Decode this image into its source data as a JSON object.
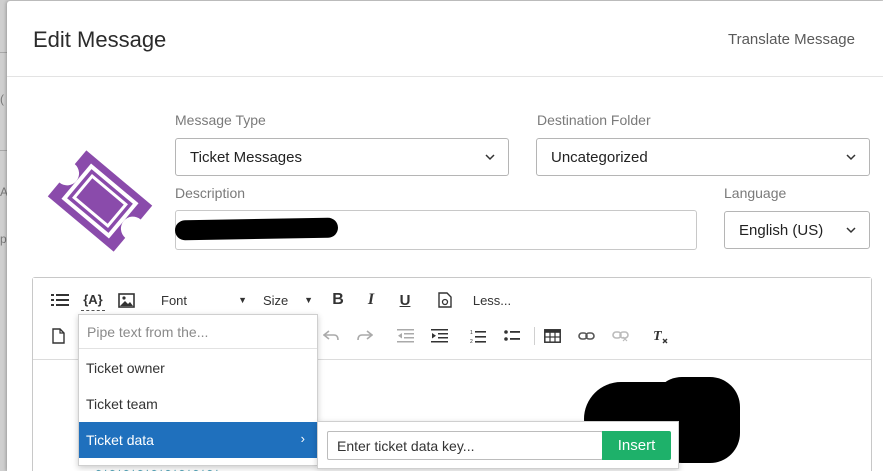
{
  "header": {
    "title": "Edit Message",
    "translate_label": "Translate Message"
  },
  "form": {
    "message_type": {
      "label": "Message Type",
      "value": "Ticket Messages"
    },
    "destination_folder": {
      "label": "Destination Folder",
      "value": "Uncategorized"
    },
    "description": {
      "label": "Description",
      "value": ""
    },
    "language": {
      "label": "Language",
      "value": "English (US)"
    }
  },
  "toolbar": {
    "font_label": "Font",
    "size_label": "Size",
    "less_label": "Less...",
    "bold_icon": "bold-icon",
    "italic_icon": "italic-icon",
    "underline_icon": "underline-icon"
  },
  "piped_text_menu": {
    "search_placeholder": "Pipe text from the...",
    "items": [
      {
        "label": "Ticket owner"
      },
      {
        "label": "Ticket team"
      },
      {
        "label": "Ticket data",
        "active": true
      }
    ]
  },
  "submenu": {
    "key_placeholder": "Enter ticket data key...",
    "insert_label": "Insert"
  },
  "colors": {
    "ticket_logo": "#8a4bab",
    "accent_blue": "#1f70bd",
    "insert_green": "#1eb16a"
  }
}
